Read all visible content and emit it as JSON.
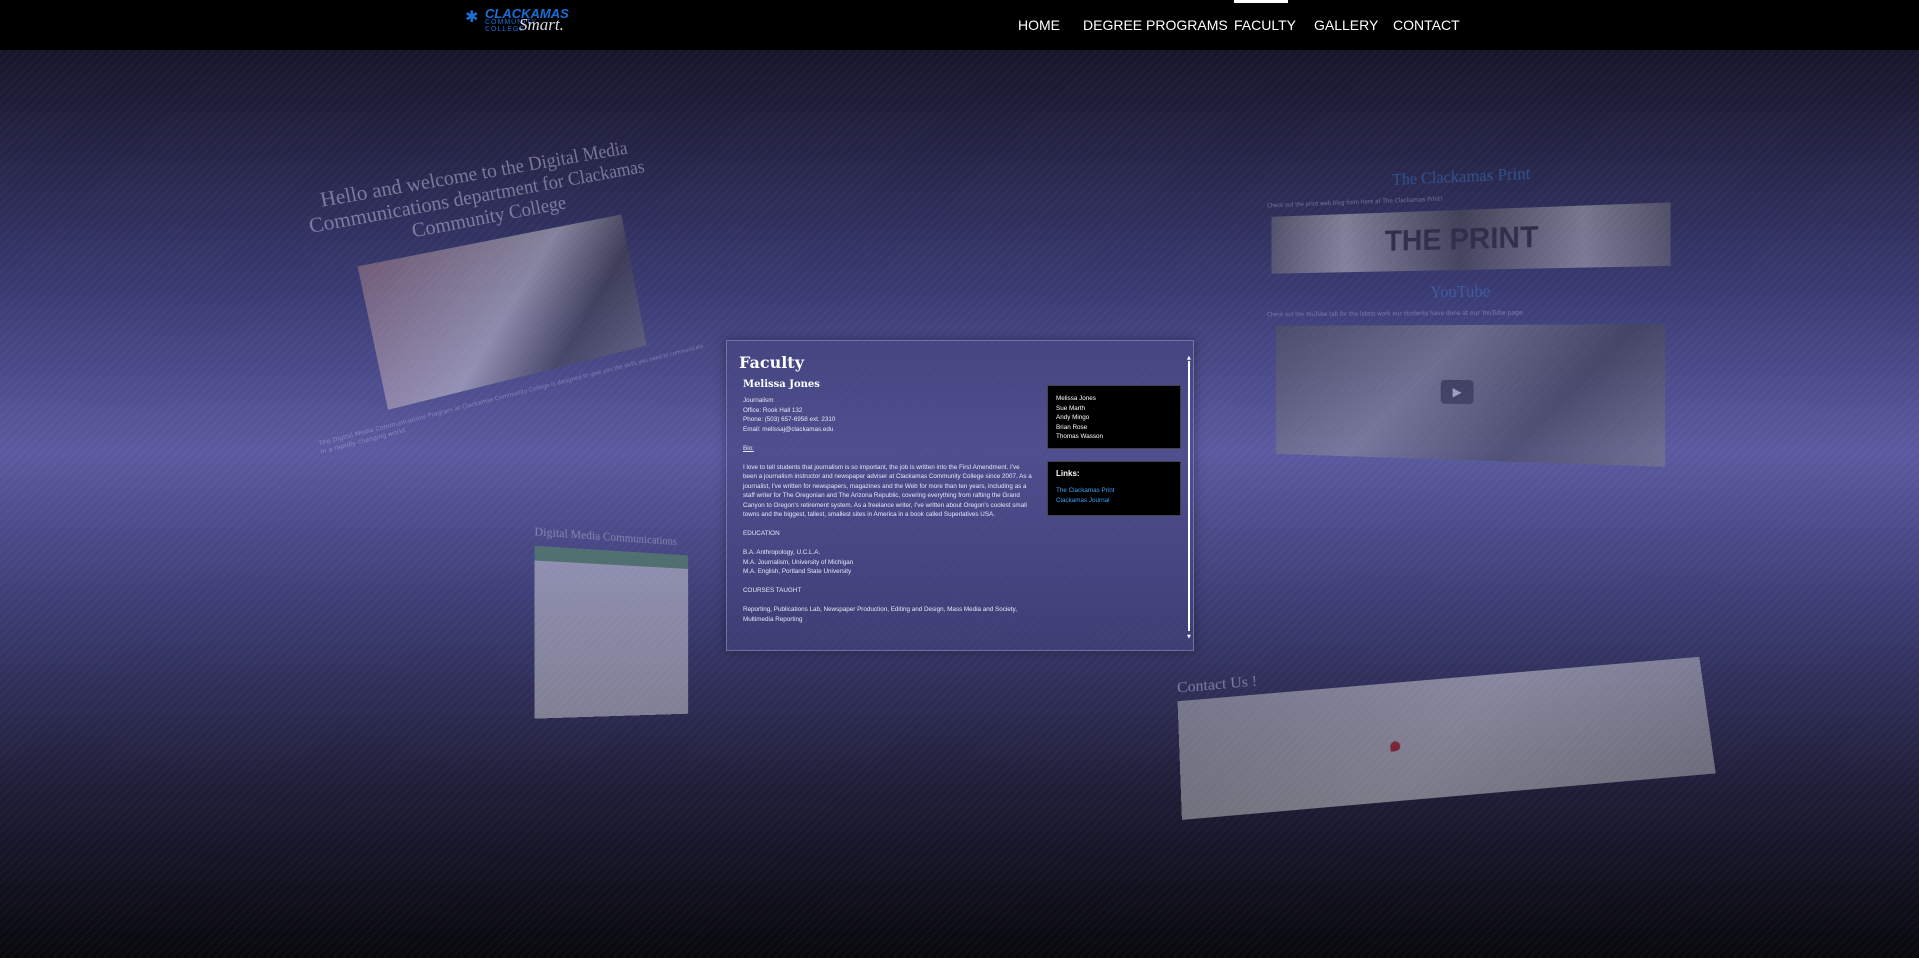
{
  "nav": {
    "logo": {
      "brand": "CLACKAMAS",
      "sub": "COMMUNITY COLLEGE",
      "script": "Smart."
    },
    "items": [
      "HOME",
      "DEGREE PROGRAMS",
      "FACULTY",
      "GALLERY",
      "CONTACT"
    ],
    "active": "FACULTY"
  },
  "welcome": {
    "title": "Hello and welcome to the Digital Media Communications department for Clackamas Community College",
    "text": "The Digital Media Communications Program at Clackamas Community College is designed to give you the skills you need to communicate in a rapidly changing world."
  },
  "print": {
    "title": "The Clackamas Print",
    "subtitle": "Check out the print web blog from here at The Clackamas Print!",
    "banner": "THE PRINT",
    "youtube_title": "YouTube",
    "youtube_sub": "Check out the YouTube tab for the latest work our students have done at our YouTube page."
  },
  "dmc": {
    "title": "Digital Media Communications"
  },
  "contact": {
    "title": "Contact Us !"
  },
  "faculty": {
    "heading": "Faculty",
    "name": "Melissa Jones",
    "role": "Journalism",
    "office": "Office: Rook Hall 132",
    "phone": "Phone: (503) 657-6958 ext. 2310",
    "email": "Email: melissaj@clackamas.edu",
    "bio_label": "Bio:",
    "bio": "I love to tell students that journalism is so important, the job is written into the First Amendment. I've been a journalism instructor and newspaper adviser at Clackamas Community College since 2007. As a journalist, I've written for newspapers, magazines and the Web for more than ten years, including as a staff writer for The Oregonian and The Arizona Republic, covering everything from rafting the Grand Canyon to Oregon's retirement system. As a freelance writer, I've written about Oregon's coolest small towns and the biggest, tallest, smallest sites in America in a book called Superlatives USA.",
    "education_label": "EDUCATION",
    "education": [
      "B.A. Anthropology, U.C.L.A.",
      "M.A. Journalism, University of Michigan",
      "M.A. English, Portland State University"
    ],
    "courses_label": "COURSES TAUGHT",
    "courses": "Reporting, Publications Lab, Newspaper Production, Editing and Design, Mass Media and Society, Multimedia Reporting",
    "faculty_list": [
      "Melissa Jones",
      "Sue Marth",
      "Andy Mingo",
      "Brian Rose",
      "Thomas Wasson"
    ],
    "links_title": "Links:",
    "links": [
      "The Clackamas Print",
      "Clackamas Journal"
    ]
  }
}
